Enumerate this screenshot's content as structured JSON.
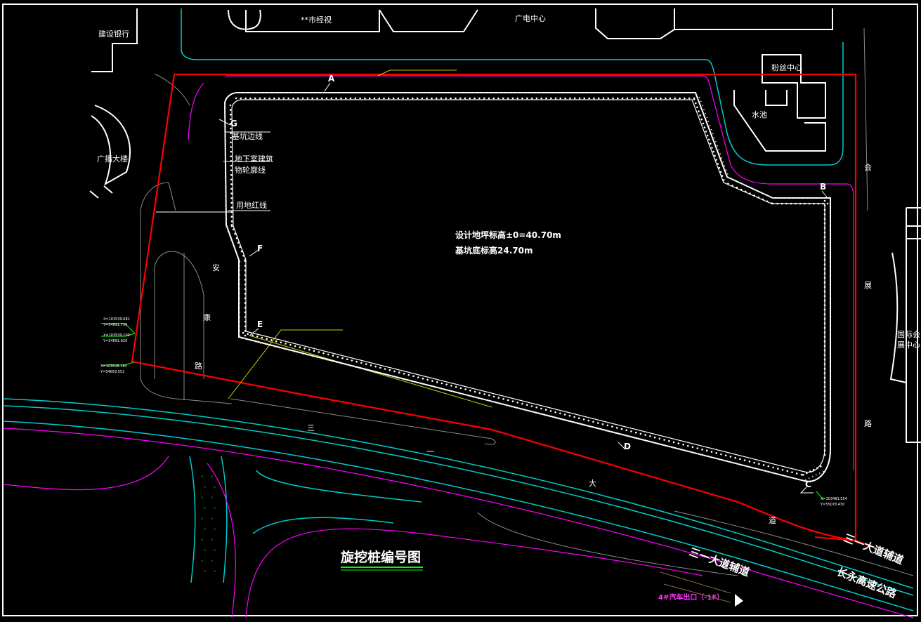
{
  "title": "旋挖桩编号图",
  "elevation": {
    "design_ground": "设计地坪标高±0=40.70m",
    "pit_bottom": "基坑底标高24.70m"
  },
  "legend_labels": {
    "pit_edge": "基坑边线",
    "basement_line_1": "地下室建筑",
    "basement_line_2": "物轮廓线",
    "property_line": "用地红线"
  },
  "corner_labels": [
    "A",
    "B",
    "C",
    "D",
    "E",
    "F",
    "G"
  ],
  "buildings": {
    "ccb": "建设银行",
    "tv": "**市经视",
    "radio_center": "广电中心",
    "radio_tower": "广播大楼",
    "silk_center": "粉丝中心",
    "water_pool": "水池",
    "expo_1": "国际会",
    "expo_2": "展中心"
  },
  "roads": {
    "an_1": "安",
    "an_2": "康",
    "an_3": "路",
    "hui_1": "会",
    "hui_2": "展",
    "hui_3": "路",
    "san_1": "三",
    "san_2": "一",
    "san_3": "大",
    "san_4": "道",
    "aux_right": "三一大道辅道",
    "aux_bottom": "三一大道辅道",
    "expressway": "长永高速公路"
  },
  "exit_label": "4#汽车出口（-1F）",
  "coordinates": {
    "c1_x": "X=103539.681",
    "c1_y": "Y=54691.799",
    "c2_x": "X=103539.100",
    "c2_y": "Y=54691.620",
    "c3_x": "X=103528.163",
    "c3_y": "Y=54659.552",
    "c4_x": "X=103481.554",
    "c4_y": "Y=55078.430"
  },
  "colors": {
    "background": "#000000",
    "property_line": "#ff0000",
    "road_edge": "#00cccc",
    "road_edge_alt": "#ff00ff",
    "piles": "#ffffff",
    "accent": "#00ff00",
    "leader": "#cccc00"
  }
}
